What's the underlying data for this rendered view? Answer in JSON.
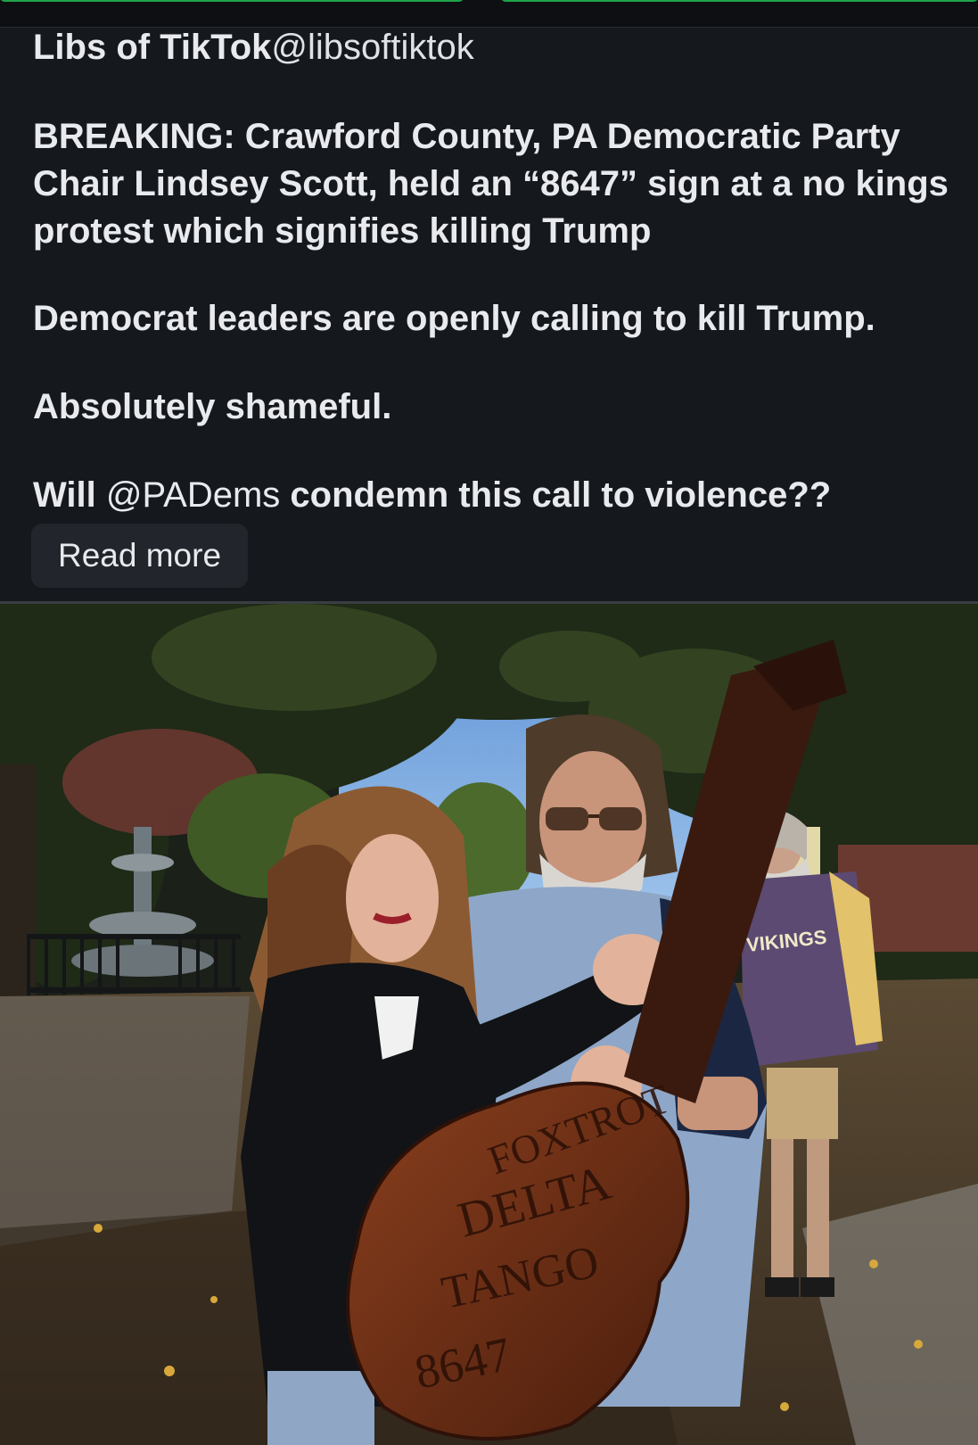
{
  "post": {
    "author_name": "Libs of TikTok",
    "author_handle": "@libsoftiktok",
    "paragraph_1": "BREAKING: Crawford County, PA Democratic Party Chair Lindsey Scott, held an “8647” sign at a no kings protest which signifies killing Trump",
    "paragraph_2": "Democrat leaders are openly calling to kill Trump.",
    "paragraph_3": "Absolutely shameful.",
    "paragraph_4_before": "Will ",
    "paragraph_4_mention": "@PADems",
    "paragraph_4_after": " condemn this call to violence??",
    "read_more_label": "Read more"
  },
  "photo": {
    "guitar_text_1": "FOXTROT",
    "guitar_text_2": "DELTA",
    "guitar_text_3": "TANGO",
    "guitar_text_4": "8647",
    "sweatshirt_text": "VIKINGS"
  },
  "colors": {
    "background": "#15181d",
    "text": "#e8eaed",
    "button_bg": "#22262c",
    "top_pill": "#1fa34a"
  }
}
